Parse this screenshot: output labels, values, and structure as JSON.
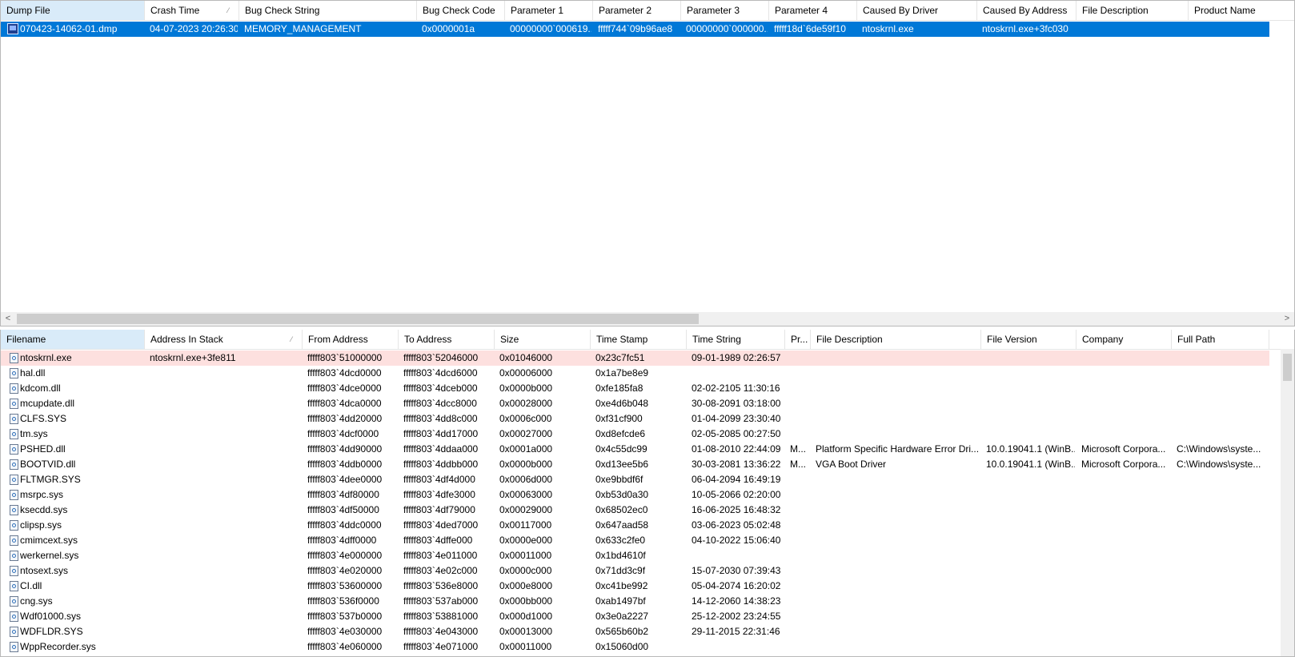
{
  "top_table": {
    "columns": [
      "Dump File",
      "Crash Time",
      "Bug Check String",
      "Bug Check Code",
      "Parameter 1",
      "Parameter 2",
      "Parameter 3",
      "Parameter 4",
      "Caused By Driver",
      "Caused By Address",
      "File Description",
      "Product Name"
    ],
    "sort_indicator": "⁄",
    "rows": [
      [
        "070423-14062-01.dmp",
        "04-07-2023 20:26:30",
        "MEMORY_MANAGEMENT",
        "0x0000001a",
        "00000000`000619...",
        "fffff744`09b96ae8",
        "00000000`000000...",
        "fffff18d`6de59f10",
        "ntoskrnl.exe",
        "ntoskrnl.exe+3fc030",
        "",
        ""
      ]
    ]
  },
  "bottom_table": {
    "columns": [
      "Filename",
      "Address In Stack",
      "From Address",
      "To Address",
      "Size",
      "Time Stamp",
      "Time String",
      "Pr...",
      "File Description",
      "File Version",
      "Company",
      "Full Path"
    ],
    "sort_indicator": "⁄",
    "rows": [
      [
        "ntoskrnl.exe",
        "ntoskrnl.exe+3fe811",
        "fffff803`51000000",
        "fffff803`52046000",
        "0x01046000",
        "0x23c7fc51",
        "09-01-1989 02:26:57",
        "",
        "",
        "",
        "",
        ""
      ],
      [
        "hal.dll",
        "",
        "fffff803`4dcd0000",
        "fffff803`4dcd6000",
        "0x00006000",
        "0x1a7be8e9",
        "",
        "",
        "",
        "",
        "",
        ""
      ],
      [
        "kdcom.dll",
        "",
        "fffff803`4dce0000",
        "fffff803`4dceb000",
        "0x0000b000",
        "0xfe185fa8",
        "02-02-2105 11:30:16",
        "",
        "",
        "",
        "",
        ""
      ],
      [
        "mcupdate.dll",
        "",
        "fffff803`4dca0000",
        "fffff803`4dcc8000",
        "0x00028000",
        "0xe4d6b048",
        "30-08-2091 03:18:00",
        "",
        "",
        "",
        "",
        ""
      ],
      [
        "CLFS.SYS",
        "",
        "fffff803`4dd20000",
        "fffff803`4dd8c000",
        "0x0006c000",
        "0xf31cf900",
        "01-04-2099 23:30:40",
        "",
        "",
        "",
        "",
        ""
      ],
      [
        "tm.sys",
        "",
        "fffff803`4dcf0000",
        "fffff803`4dd17000",
        "0x00027000",
        "0xd8efcde6",
        "02-05-2085 00:27:50",
        "",
        "",
        "",
        "",
        ""
      ],
      [
        "PSHED.dll",
        "",
        "fffff803`4dd90000",
        "fffff803`4ddaa000",
        "0x0001a000",
        "0x4c55dc99",
        "01-08-2010 22:44:09",
        "M...",
        "Platform Specific Hardware Error Dri...",
        "10.0.19041.1 (WinB...",
        "Microsoft Corpora...",
        "C:\\Windows\\syste..."
      ],
      [
        "BOOTVID.dll",
        "",
        "fffff803`4ddb0000",
        "fffff803`4ddbb000",
        "0x0000b000",
        "0xd13ee5b6",
        "30-03-2081 13:36:22",
        "M...",
        "VGA Boot Driver",
        "10.0.19041.1 (WinB...",
        "Microsoft Corpora...",
        "C:\\Windows\\syste..."
      ],
      [
        "FLTMGR.SYS",
        "",
        "fffff803`4dee0000",
        "fffff803`4df4d000",
        "0x0006d000",
        "0xe9bbdf6f",
        "06-04-2094 16:49:19",
        "",
        "",
        "",
        "",
        ""
      ],
      [
        "msrpc.sys",
        "",
        "fffff803`4df80000",
        "fffff803`4dfe3000",
        "0x00063000",
        "0xb53d0a30",
        "10-05-2066 02:20:00",
        "",
        "",
        "",
        "",
        ""
      ],
      [
        "ksecdd.sys",
        "",
        "fffff803`4df50000",
        "fffff803`4df79000",
        "0x00029000",
        "0x68502ec0",
        "16-06-2025 16:48:32",
        "",
        "",
        "",
        "",
        ""
      ],
      [
        "clipsp.sys",
        "",
        "fffff803`4ddc0000",
        "fffff803`4ded7000",
        "0x00117000",
        "0x647aad58",
        "03-06-2023 05:02:48",
        "",
        "",
        "",
        "",
        ""
      ],
      [
        "cmimcext.sys",
        "",
        "fffff803`4dff0000",
        "fffff803`4dffe000",
        "0x0000e000",
        "0x633c2fe0",
        "04-10-2022 15:06:40",
        "",
        "",
        "",
        "",
        ""
      ],
      [
        "werkernel.sys",
        "",
        "fffff803`4e000000",
        "fffff803`4e011000",
        "0x00011000",
        "0x1bd4610f",
        "",
        "",
        "",
        "",
        "",
        ""
      ],
      [
        "ntosext.sys",
        "",
        "fffff803`4e020000",
        "fffff803`4e02c000",
        "0x0000c000",
        "0x71dd3c9f",
        "15-07-2030 07:39:43",
        "",
        "",
        "",
        "",
        ""
      ],
      [
        "CI.dll",
        "",
        "fffff803`53600000",
        "fffff803`536e8000",
        "0x000e8000",
        "0xc41be992",
        "05-04-2074 16:20:02",
        "",
        "",
        "",
        "",
        ""
      ],
      [
        "cng.sys",
        "",
        "fffff803`536f0000",
        "fffff803`537ab000",
        "0x000bb000",
        "0xab1497bf",
        "14-12-2060 14:38:23",
        "",
        "",
        "",
        "",
        ""
      ],
      [
        "Wdf01000.sys",
        "",
        "fffff803`537b0000",
        "fffff803`53881000",
        "0x000d1000",
        "0x3e0a2227",
        "25-12-2002 23:24:55",
        "",
        "",
        "",
        "",
        ""
      ],
      [
        "WDFLDR.SYS",
        "",
        "fffff803`4e030000",
        "fffff803`4e043000",
        "0x00013000",
        "0x565b60b2",
        "29-11-2015 22:31:46",
        "",
        "",
        "",
        "",
        ""
      ],
      [
        "WppRecorder.sys",
        "",
        "fffff803`4e060000",
        "fffff803`4e071000",
        "0x00011000",
        "0x15060d00",
        "",
        "",
        "",
        "",
        "",
        ""
      ]
    ]
  },
  "colors": {
    "selection": "#0078d7",
    "stack_hit": "#fde0df",
    "sorted_header": "#d9ebf9"
  },
  "icons": {
    "dump_file": "dump-file-icon",
    "module_file": "module-file-icon"
  },
  "scrollbar_arrows": {
    "left": "<",
    "right": ">",
    "up": "▲",
    "down": "▼"
  }
}
